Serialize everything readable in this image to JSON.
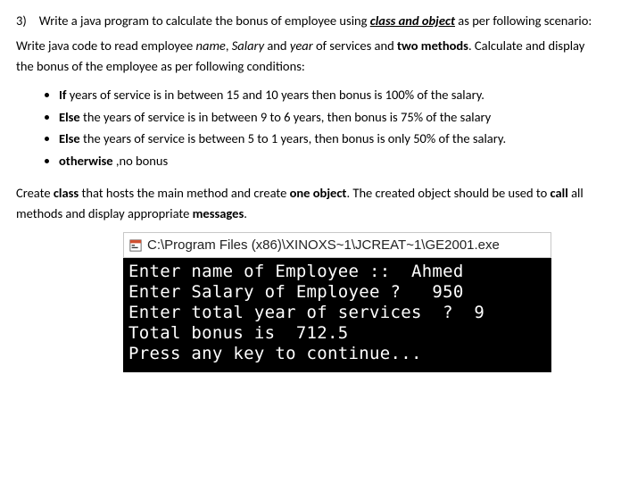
{
  "question": {
    "number": "3)",
    "text_lead": "Write a java program to calculate the bonus of employee using ",
    "text_keyword": "class and object",
    "text_tail": " as per following scenario:"
  },
  "scenario_para": {
    "pre": "Write java code to read employee ",
    "name": "name",
    "sep1": ", ",
    "salary": "Salary",
    "sep2": " and ",
    "year": "year",
    "sep3": " of services and ",
    "methods": "two methods",
    "post": ". Calculate and display the bonus of the employee as per following conditions:"
  },
  "conditions": [
    {
      "lead": "If",
      "rest": " years of service is in between 15 and 10 years then bonus is 100% of the salary."
    },
    {
      "lead": "Else",
      "rest": " the years of service is in between 9 to 6 years, then bonus is 75% of the salary"
    },
    {
      "lead": "Else",
      "rest": " the years of service is between 5 to 1 years, then bonus is only 50% of the salary."
    },
    {
      "lead": "otherwise",
      "rest": " ,no bonus"
    }
  ],
  "closing": {
    "p1a": "Create ",
    "p1b": "class",
    "p1c": " that hosts the main method and create ",
    "p1d": "one object",
    "p1e": ". The created object should be used to ",
    "p1f": "call",
    "p1g": " all methods and display appropriate ",
    "p1h": "messages",
    "p1i": "."
  },
  "console": {
    "title": "C:\\Program Files (x86)\\XINOXS~1\\JCREAT~1\\GE2001.exe",
    "lines": [
      "Enter name of Employee ::  Ahmed",
      "Enter Salary of Employee ?   950",
      "Enter total year of services  ?  9",
      "Total bonus is  712.5",
      "Press any key to continue..."
    ]
  }
}
